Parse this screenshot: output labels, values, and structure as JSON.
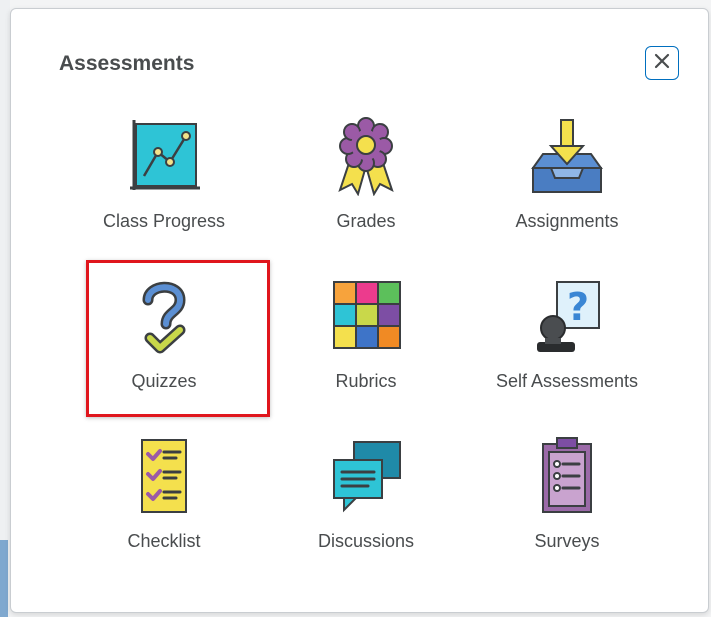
{
  "dialog": {
    "title": "Assessments",
    "close_label": "×"
  },
  "tiles": [
    {
      "label": "Class Progress",
      "icon": "class-progress-icon"
    },
    {
      "label": "Grades",
      "icon": "grades-ribbon-icon"
    },
    {
      "label": "Assignments",
      "icon": "assignments-inbox-icon"
    },
    {
      "label": "Quizzes",
      "icon": "quizzes-question-icon"
    },
    {
      "label": "Rubrics",
      "icon": "rubrics-grid-icon"
    },
    {
      "label": "Self Assessments",
      "icon": "self-assessments-icon"
    },
    {
      "label": "Checklist",
      "icon": "checklist-icon"
    },
    {
      "label": "Discussions",
      "icon": "discussions-icon"
    },
    {
      "label": "Surveys",
      "icon": "surveys-clipboard-icon"
    }
  ],
  "highlighted_tile": "Quizzes",
  "colors": {
    "accent_blue": "#006fbf",
    "highlight_red": "#e0161d",
    "text": "#494c4e"
  }
}
